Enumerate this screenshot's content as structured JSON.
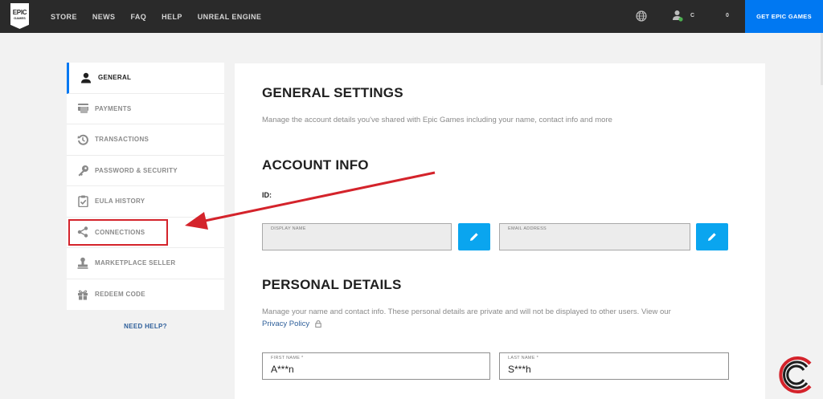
{
  "nav": {
    "logo_line1": "EPIC",
    "logo_line2": "GAMES",
    "links": [
      "STORE",
      "NEWS",
      "FAQ",
      "HELP",
      "UNREAL ENGINE"
    ],
    "user_initial": "C",
    "count": "0",
    "cta": "GET EPIC GAMES"
  },
  "sidebar": {
    "items": [
      {
        "label": "GENERAL",
        "icon": "person-icon",
        "active": true
      },
      {
        "label": "PAYMENTS",
        "icon": "payments-icon",
        "active": false
      },
      {
        "label": "TRANSACTIONS",
        "icon": "history-icon",
        "active": false
      },
      {
        "label": "PASSWORD & SECURITY",
        "icon": "key-icon",
        "active": false
      },
      {
        "label": "EULA HISTORY",
        "icon": "clipboard-check-icon",
        "active": false
      },
      {
        "label": "CONNECTIONS",
        "icon": "share-icon",
        "active": false
      },
      {
        "label": "MARKETPLACE SELLER",
        "icon": "stamp-icon",
        "active": false
      },
      {
        "label": "REDEEM CODE",
        "icon": "gift-icon",
        "active": false
      }
    ],
    "need_help": "NEED HELP?"
  },
  "main": {
    "title": "GENERAL SETTINGS",
    "subtitle": "Manage the account details you've shared with Epic Games including your name, contact info and more",
    "account_info": {
      "heading": "ACCOUNT INFO",
      "id_label": "ID:",
      "display_name_label": "DISPLAY NAME",
      "email_label": "EMAIL ADDRESS"
    },
    "personal_details": {
      "heading": "PERSONAL DETAILS",
      "text": "Manage your name and contact info. These personal details are private and will not be displayed to other users. View our",
      "privacy_link": "Privacy Policy",
      "first_name_label": "FIRST NAME *",
      "first_name_value": "A***n",
      "last_name_label": "LAST NAME *",
      "last_name_value": "S***h"
    }
  },
  "colors": {
    "nav_bg": "#2a2a2a",
    "accent": "#0078f2",
    "edit_button": "#0aa5ef",
    "annotation": "#d4232b"
  }
}
